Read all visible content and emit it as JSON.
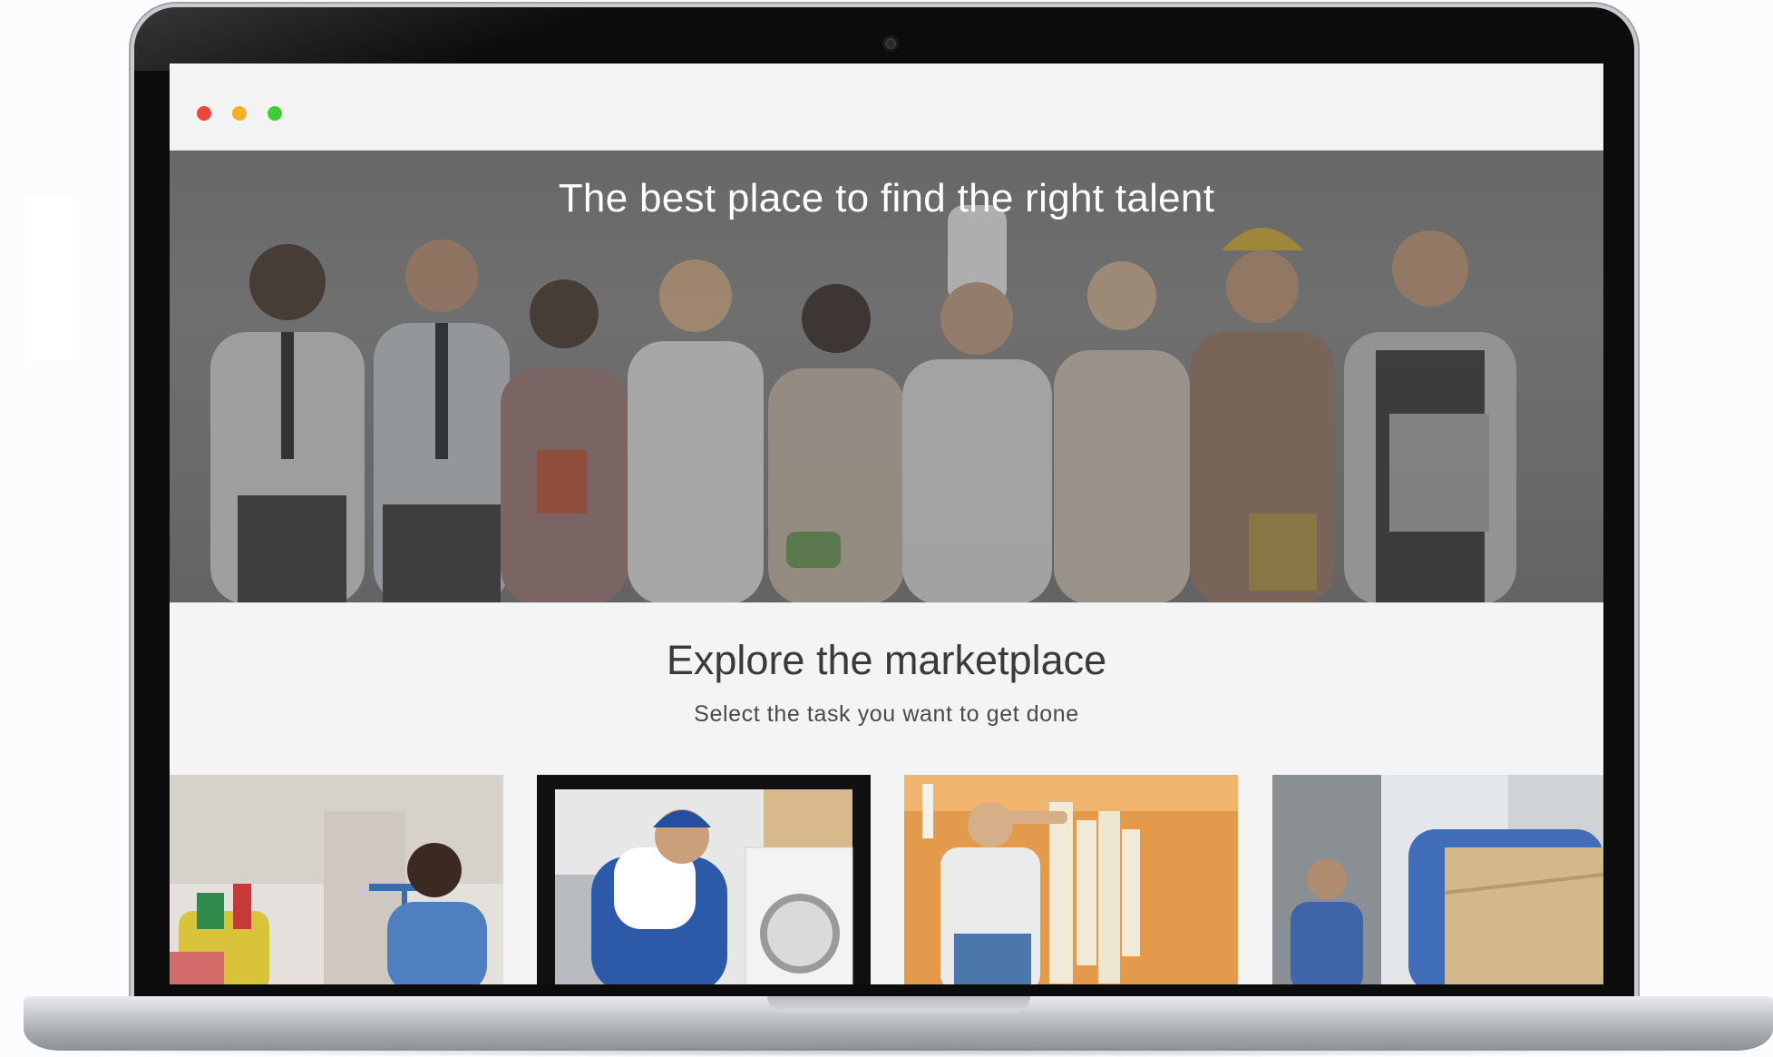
{
  "window": {
    "controls": [
      "close",
      "minimize",
      "maximize"
    ]
  },
  "hero": {
    "title": "The best place to find the right talent"
  },
  "marketplace": {
    "title": "Explore the marketplace",
    "subtitle": "Select the task you want to get done",
    "cards": [
      {
        "name": "cleaning-card"
      },
      {
        "name": "appliance-repair-card"
      },
      {
        "name": "painting-card"
      },
      {
        "name": "moving-card"
      }
    ]
  },
  "colors": {
    "close": "#f1453c",
    "minimize": "#f5b124",
    "maximize": "#3fcd33",
    "hero_overlay": "#6f6f6f",
    "page_background": "#f4f4f4"
  }
}
